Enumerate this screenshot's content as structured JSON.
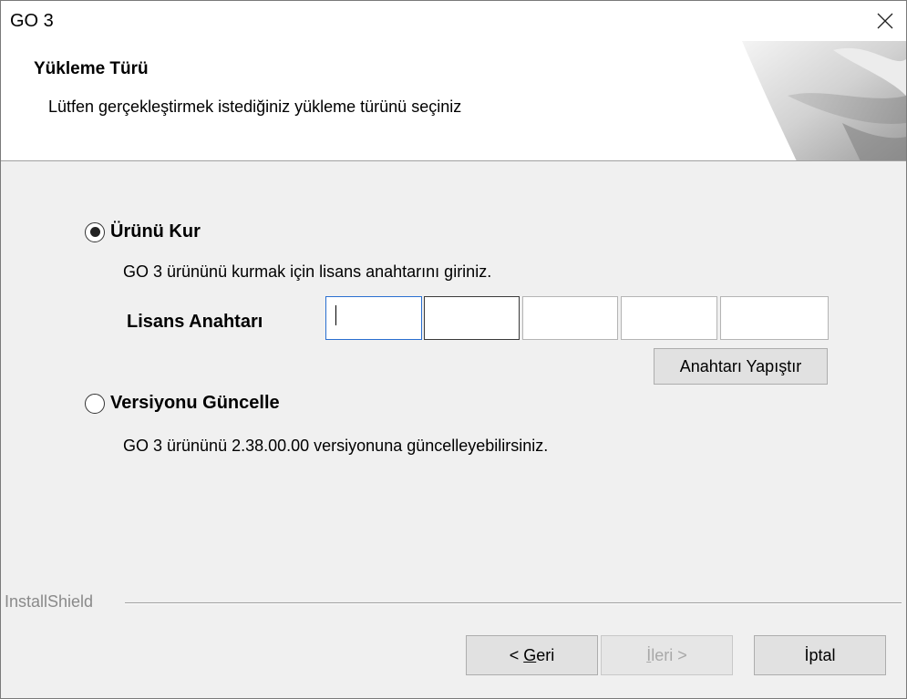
{
  "window": {
    "title": "GO 3"
  },
  "header": {
    "title": "Yükleme Türü",
    "subtitle": "Lütfen gerçekleştirmek istediğiniz yükleme türünü seçiniz"
  },
  "options": {
    "install": {
      "label": "Ürünü Kur",
      "selected": true,
      "description": "GO 3 ürününü kurmak için lisans anahtarını giriniz."
    },
    "update": {
      "label": "Versiyonu Güncelle",
      "selected": false,
      "description": "GO 3 ürününü 2.38.00.00 versiyonuna güncelleyebilirsiniz."
    }
  },
  "license": {
    "label": "Lisans Anahtarı",
    "fields": [
      "",
      "",
      "",
      "",
      ""
    ],
    "paste_button": "Anahtarı Yapıştır"
  },
  "footer": {
    "brand": "InstallShield",
    "back_prefix": "< ",
    "back_mnemonic": "G",
    "back_rest": "eri",
    "next_mnemonic": "İ",
    "next_rest": "leri >",
    "cancel": "İptal"
  },
  "icons": {
    "close": "close-icon",
    "corner": "installshield-corner-graphic"
  }
}
